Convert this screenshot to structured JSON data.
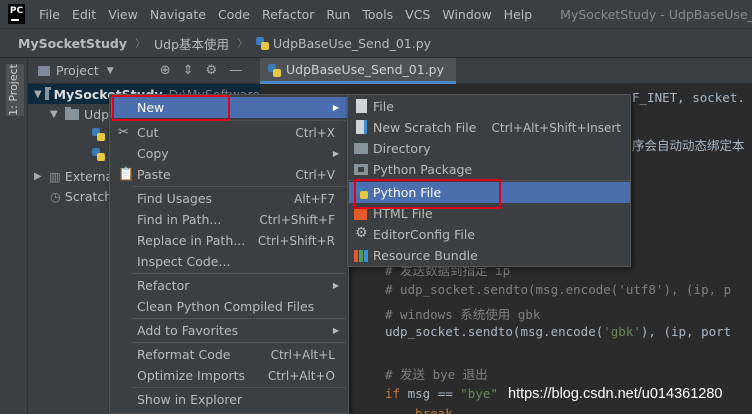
{
  "menubar": {
    "logo": "PC",
    "items": [
      "File",
      "Edit",
      "View",
      "Navigate",
      "Code",
      "Refactor",
      "Run",
      "Tools",
      "VCS",
      "Window",
      "Help"
    ],
    "title": "MySocketStudy - UdpBaseUse_Send"
  },
  "breadcrumb": {
    "project": "MySocketStudy",
    "folder": "Udp基本使用",
    "file": "UdpBaseUse_Send_01.py"
  },
  "left_strip": {
    "project_tab": "1: Project"
  },
  "panel": {
    "title": "Project",
    "dropdown_icon": "chevron-down-icon",
    "icons": [
      "crosshair-icon",
      "collapse-icon",
      "gear-icon",
      "minimize-icon"
    ]
  },
  "tree": {
    "root": "MySocketStudy",
    "root_path": "D:\\MySoftware",
    "folder": "Udp",
    "external": "Externa",
    "scratches": "Scratch"
  },
  "editor": {
    "tab": "UdpBaseUse_Send_01.py",
    "visible_top_fragment": "F_INET, socket.",
    "visible_comment_fragment": "序会自动动态绑定本",
    "lines": [
      {
        "text": "# 发送数据到指定 ip",
        "cls": "comment"
      },
      {
        "text": "# udp_socket.sendto(msg.encode('utf8'), (ip, p",
        "cls": "comment"
      },
      {
        "text": "# windows 系统使用 gbk",
        "cls": "comment"
      },
      {
        "prefix": "udp_socket.sendto(msg.encode(",
        "str": "'gbk'",
        "suffix": "), (ip, port"
      },
      {
        "text": "",
        "cls": ""
      },
      {
        "text": "# 发送 bye 退出",
        "cls": "comment"
      },
      {
        "kw": "if",
        "mid": " msg == ",
        "str": "\"bye\""
      },
      {
        "text": "    break",
        "cls": "kw"
      }
    ],
    "watermark": "https://blog.csdn.net/u014361280"
  },
  "context_menu": {
    "items": [
      {
        "label": "New",
        "shortcut": "",
        "submenu": true,
        "icon": ""
      },
      {
        "label": "Cut",
        "shortcut": "Ctrl+X",
        "icon": "cut-icon"
      },
      {
        "label": "Copy",
        "shortcut": "",
        "submenu": true,
        "icon": ""
      },
      {
        "label": "Paste",
        "shortcut": "Ctrl+V",
        "icon": "paste-icon"
      },
      {
        "label": "Find Usages",
        "shortcut": "Alt+F7",
        "icon": ""
      },
      {
        "label": "Find in Path...",
        "shortcut": "Ctrl+Shift+F",
        "icon": ""
      },
      {
        "label": "Replace in Path...",
        "shortcut": "Ctrl+Shift+R",
        "icon": ""
      },
      {
        "label": "Inspect Code...",
        "shortcut": "",
        "icon": ""
      },
      {
        "label": "Refactor",
        "shortcut": "",
        "submenu": true,
        "icon": ""
      },
      {
        "label": "Clean Python Compiled Files",
        "shortcut": "",
        "icon": ""
      },
      {
        "label": "Add to Favorites",
        "shortcut": "",
        "submenu": true,
        "icon": ""
      },
      {
        "label": "Reformat Code",
        "shortcut": "Ctrl+Alt+L",
        "icon": ""
      },
      {
        "label": "Optimize Imports",
        "shortcut": "Ctrl+Alt+O",
        "icon": ""
      },
      {
        "label": "Show in Explorer",
        "shortcut": "",
        "icon": ""
      }
    ]
  },
  "new_submenu": {
    "items": [
      {
        "label": "File",
        "shortcut": "",
        "icon": "file-icon"
      },
      {
        "label": "New Scratch File",
        "shortcut": "Ctrl+Alt+Shift+Insert",
        "icon": "scratch-file-icon"
      },
      {
        "label": "Directory",
        "shortcut": "",
        "icon": "folder-icon"
      },
      {
        "label": "Python Package",
        "shortcut": "",
        "icon": "package-icon"
      },
      {
        "label": "Python File",
        "shortcut": "",
        "icon": "python-file-icon"
      },
      {
        "label": "HTML File",
        "shortcut": "",
        "icon": "html-file-icon"
      },
      {
        "label": "EditorConfig File",
        "shortcut": "",
        "icon": "editorconfig-icon"
      },
      {
        "label": "Resource Bundle",
        "shortcut": "",
        "icon": "resource-bundle-icon"
      }
    ]
  },
  "colors": {
    "menu_highlight": "#4b6eaf",
    "annotation_red": "#e0001a",
    "panel_bg": "#3c3f41",
    "editor_bg": "#2b2b2b"
  }
}
